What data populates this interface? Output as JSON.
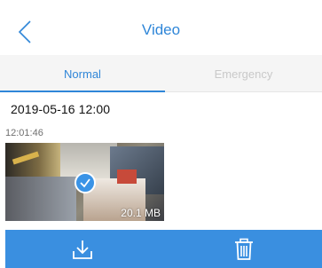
{
  "header": {
    "title": "Video",
    "back_icon": "chevron-left-icon"
  },
  "tabs": [
    {
      "label": "Normal",
      "active": true
    },
    {
      "label": "Emergency",
      "active": false
    }
  ],
  "recording": {
    "date_time": "2019-05-16 12:00",
    "time": "12:01:46",
    "size": "20.1 MB",
    "selected": true
  },
  "toolbar": {
    "download_icon": "download-icon",
    "delete_icon": "trash-icon"
  },
  "colors": {
    "accent": "#2f86d8",
    "toolbar": "#3a8fe0",
    "inactive_tab": "#c9c9c9",
    "tab_background": "#f5f5f5"
  }
}
